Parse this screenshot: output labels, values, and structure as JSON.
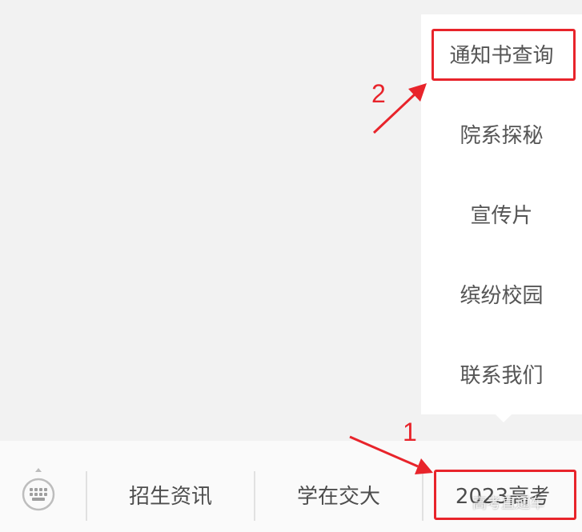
{
  "popup_menu": {
    "items": [
      {
        "label": "通知书查询"
      },
      {
        "label": "院系探秘"
      },
      {
        "label": "宣传片"
      },
      {
        "label": "缤纷校园"
      },
      {
        "label": "联系我们"
      }
    ]
  },
  "bottom_bar": {
    "items": [
      {
        "label": "招生资讯"
      },
      {
        "label": "学在交大"
      },
      {
        "label": "2023高考"
      }
    ]
  },
  "annotations": {
    "step1": "1",
    "step2": "2",
    "accent_color": "#e8242b"
  },
  "watermark": {
    "text": "高考直通车"
  },
  "icons": {
    "keyboard": "keyboard-icon"
  }
}
